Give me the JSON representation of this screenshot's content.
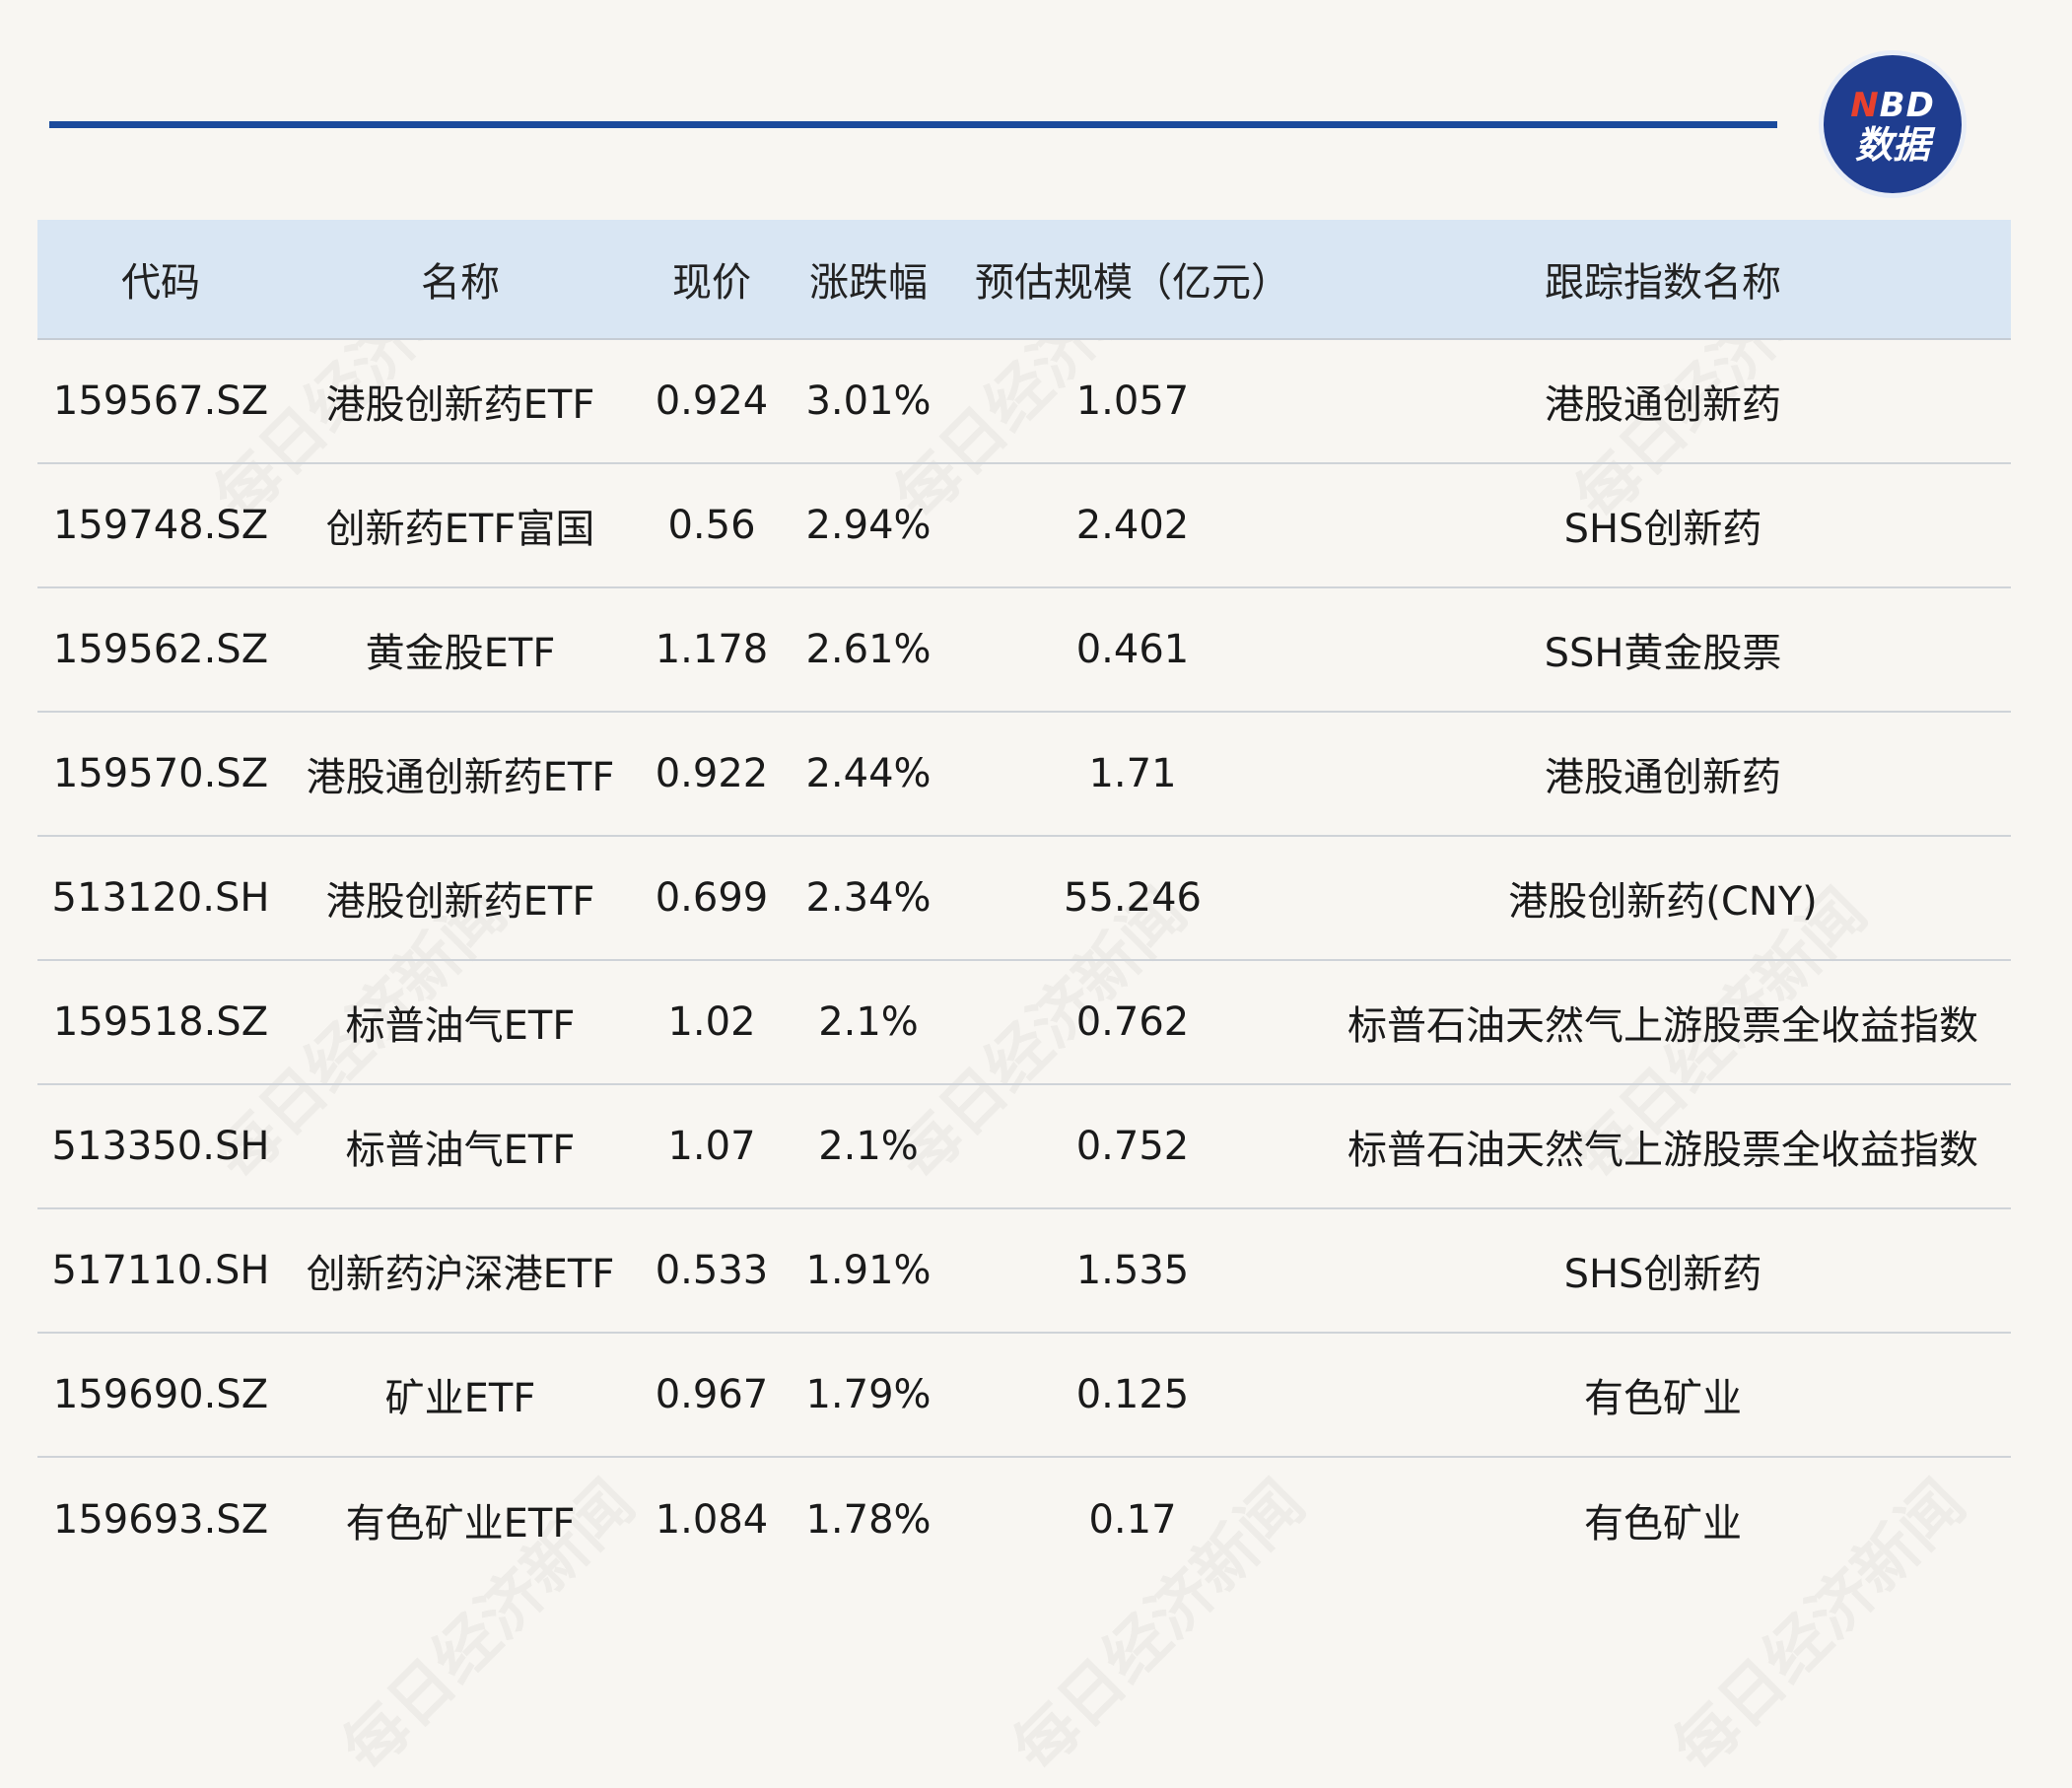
{
  "logo": {
    "line1_n": "N",
    "line1_rest": "BD",
    "line2": "数据"
  },
  "watermark_text": "每日经济新闻",
  "table": {
    "headers": {
      "code": "代码",
      "name": "名称",
      "price": "现价",
      "change": "涨跌幅",
      "size": "预估规模（亿元）",
      "index": "跟踪指数名称"
    },
    "rows": [
      {
        "code": "159567.SZ",
        "name": "港股创新药ETF",
        "price": "0.924",
        "change": "3.01%",
        "size": "1.057",
        "index": "港股通创新药"
      },
      {
        "code": "159748.SZ",
        "name": "创新药ETF富国",
        "price": "0.56",
        "change": "2.94%",
        "size": "2.402",
        "index": "SHS创新药"
      },
      {
        "code": "159562.SZ",
        "name": "黄金股ETF",
        "price": "1.178",
        "change": "2.61%",
        "size": "0.461",
        "index": "SSH黄金股票"
      },
      {
        "code": "159570.SZ",
        "name": "港股通创新药ETF",
        "price": "0.922",
        "change": "2.44%",
        "size": "1.71",
        "index": "港股通创新药"
      },
      {
        "code": "513120.SH",
        "name": "港股创新药ETF",
        "price": "0.699",
        "change": "2.34%",
        "size": "55.246",
        "index": "港股创新药(CNY)"
      },
      {
        "code": "159518.SZ",
        "name": "标普油气ETF",
        "price": "1.02",
        "change": "2.1%",
        "size": "0.762",
        "index": "标普石油天然气上游股票全收益指数"
      },
      {
        "code": "513350.SH",
        "name": "标普油气ETF",
        "price": "1.07",
        "change": "2.1%",
        "size": "0.752",
        "index": "标普石油天然气上游股票全收益指数"
      },
      {
        "code": "517110.SH",
        "name": "创新药沪深港ETF",
        "price": "0.533",
        "change": "1.91%",
        "size": "1.535",
        "index": "SHS创新药"
      },
      {
        "code": "159690.SZ",
        "name": "矿业ETF",
        "price": "0.967",
        "change": "1.79%",
        "size": "0.125",
        "index": "有色矿业"
      },
      {
        "code": "159693.SZ",
        "name": "有色矿业ETF",
        "price": "1.084",
        "change": "1.78%",
        "size": "0.17",
        "index": "有色矿业"
      }
    ]
  },
  "colors": {
    "background": "#f8f6f2",
    "header_bg": "#d9e6f3",
    "rule": "#1a4a9c",
    "logo_bg": "#1f3d8f",
    "logo_accent": "#e8412d"
  }
}
